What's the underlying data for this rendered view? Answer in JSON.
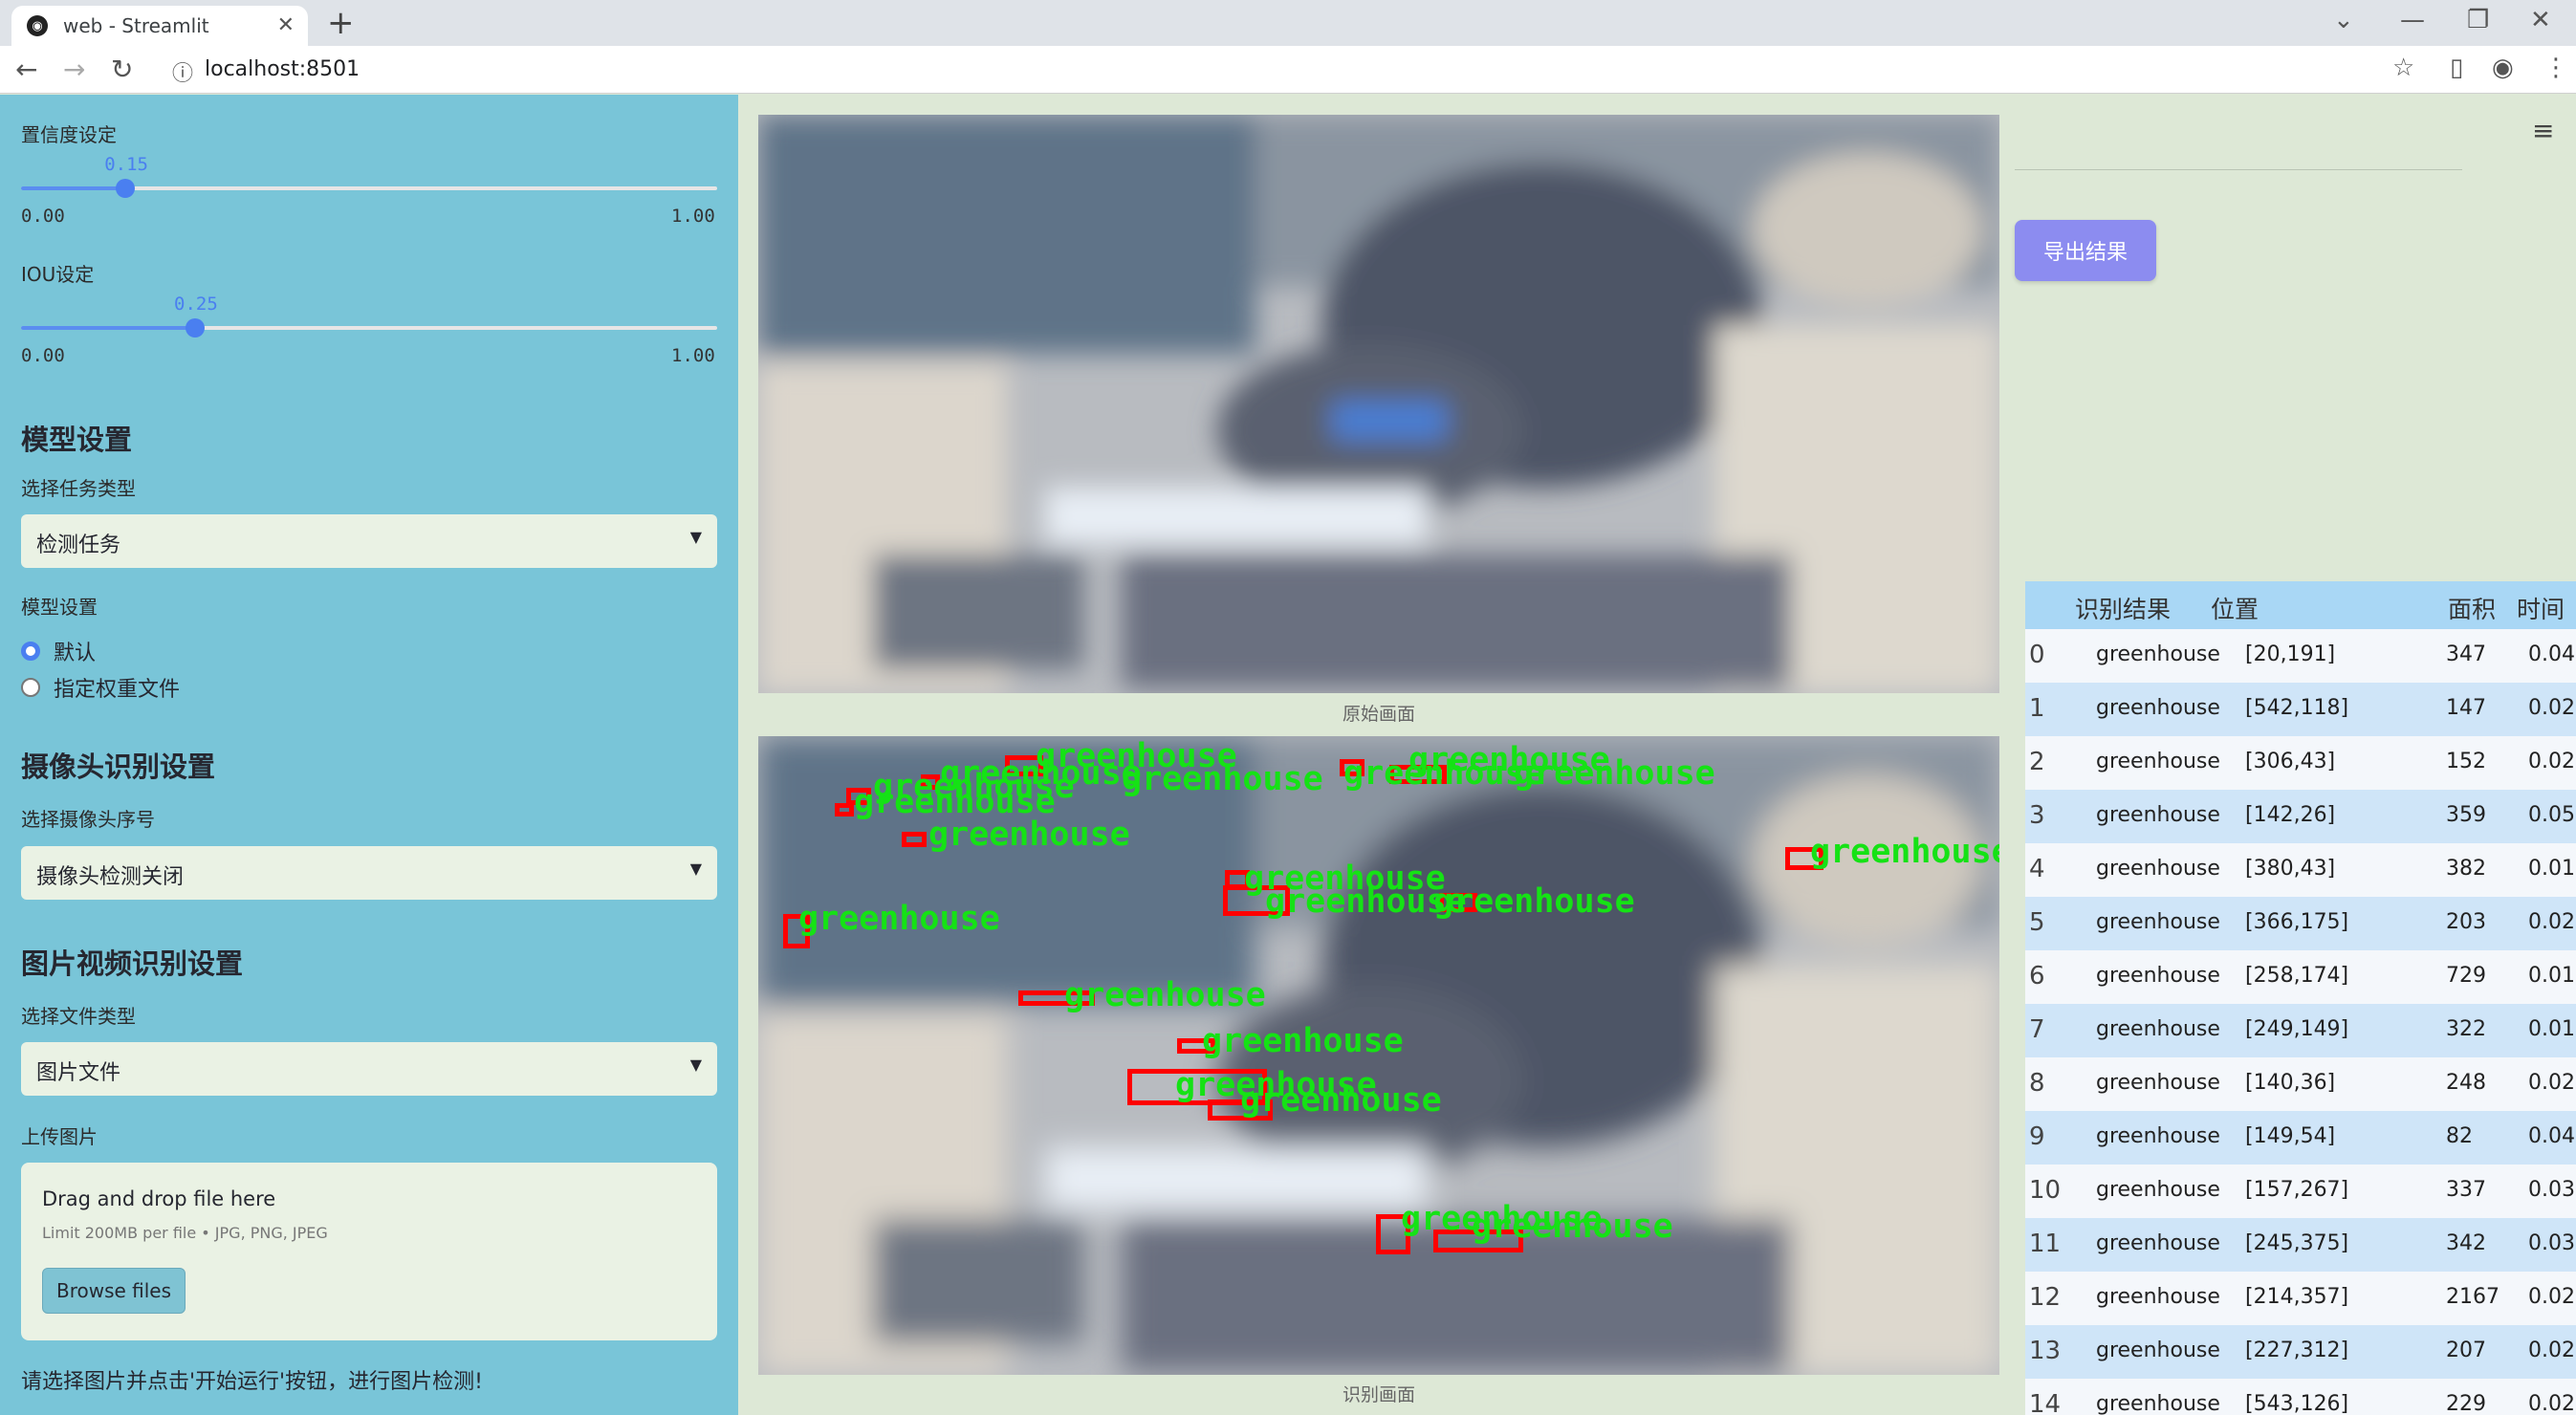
{
  "browser": {
    "tab_title": "web - Streamlit",
    "url": "localhost:8501"
  },
  "sidebar": {
    "confidence": {
      "label": "置信度设定",
      "value": "0.15",
      "value_num": 0.15,
      "min": "0.00",
      "max": "1.00"
    },
    "iou": {
      "label": "IOU设定",
      "value": "0.25",
      "value_num": 0.25,
      "min": "0.00",
      "max": "1.00"
    },
    "model_section": {
      "title": "模型设置",
      "task_label": "选择任务类型",
      "task_value": "检测任务",
      "model_label": "模型设置",
      "options": [
        "默认",
        "指定权重文件"
      ],
      "selected": 0
    },
    "camera_section": {
      "title": "摄像头识别设置",
      "camera_label": "选择摄像头序号",
      "camera_value": "摄像头检测关闭"
    },
    "media_section": {
      "title": "图片视频识别设置",
      "file_type_label": "选择文件类型",
      "file_type_value": "图片文件",
      "upload_label": "上传图片",
      "drop_text": "Drag and drop file here",
      "limit_text": "Limit 200MB per file • JPG, PNG, JPEG",
      "browse_label": "Browse files"
    },
    "bottom_note": "请选择图片并点击'开始运行'按钮，进行图片检测!"
  },
  "main": {
    "original_caption": "原始画面",
    "result_caption": "识别画面",
    "detection_label": "greenhouse"
  },
  "right": {
    "export_label": "导出结果",
    "table": {
      "headers": [
        "识别结果",
        "位置",
        "面积",
        "时间"
      ],
      "rows": [
        {
          "idx": "0",
          "cls": "greenhouse",
          "pos": "[20,191]",
          "area": "347",
          "time": "0.04"
        },
        {
          "idx": "1",
          "cls": "greenhouse",
          "pos": "[542,118]",
          "area": "147",
          "time": "0.02"
        },
        {
          "idx": "2",
          "cls": "greenhouse",
          "pos": "[306,43]",
          "area": "152",
          "time": "0.02"
        },
        {
          "idx": "3",
          "cls": "greenhouse",
          "pos": "[142,26]",
          "area": "359",
          "time": "0.05"
        },
        {
          "idx": "4",
          "cls": "greenhouse",
          "pos": "[380,43]",
          "area": "382",
          "time": "0.01"
        },
        {
          "idx": "5",
          "cls": "greenhouse",
          "pos": "[366,175]",
          "area": "203",
          "time": "0.02"
        },
        {
          "idx": "6",
          "cls": "greenhouse",
          "pos": "[258,174]",
          "area": "729",
          "time": "0.01"
        },
        {
          "idx": "7",
          "cls": "greenhouse",
          "pos": "[249,149]",
          "area": "322",
          "time": "0.01"
        },
        {
          "idx": "8",
          "cls": "greenhouse",
          "pos": "[140,36]",
          "area": "248",
          "time": "0.02"
        },
        {
          "idx": "9",
          "cls": "greenhouse",
          "pos": "[149,54]",
          "area": "82",
          "time": "0.04"
        },
        {
          "idx": "10",
          "cls": "greenhouse",
          "pos": "[157,267]",
          "area": "337",
          "time": "0.03"
        },
        {
          "idx": "11",
          "cls": "greenhouse",
          "pos": "[245,375]",
          "area": "342",
          "time": "0.03"
        },
        {
          "idx": "12",
          "cls": "greenhouse",
          "pos": "[214,357]",
          "area": "2167",
          "time": "0.02"
        },
        {
          "idx": "13",
          "cls": "greenhouse",
          "pos": "[227,312]",
          "area": "207",
          "time": "0.02"
        },
        {
          "idx": "14",
          "cls": "greenhouse",
          "pos": "[543,126]",
          "area": "229",
          "time": "0.02"
        }
      ]
    }
  },
  "colors": {
    "sidebar_bg": "#79c5d8",
    "accent": "#4a7ff0",
    "export_button": "#8c8cf0",
    "box_color": "#ff0000",
    "label_color": "#15e215"
  }
}
